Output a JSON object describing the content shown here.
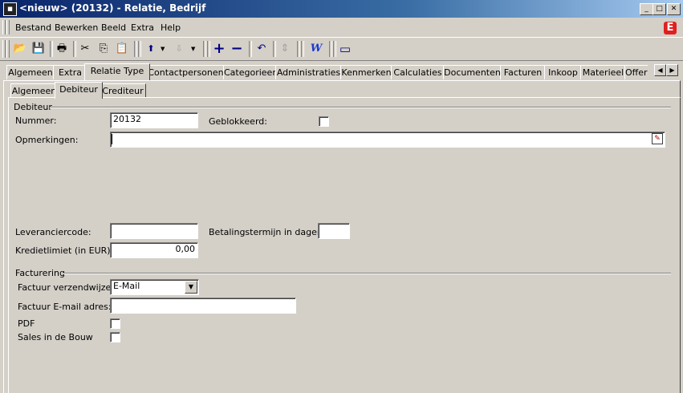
{
  "window": {
    "title": "<nieuw> (20132) - Relatie, Bedrijf",
    "minimize": "_",
    "maximize": "□",
    "close": "✕"
  },
  "menu": [
    "Bestand",
    "Bewerken",
    "Beeld",
    "Extra",
    "Help"
  ],
  "toolbar": {
    "icons": [
      "open-icon",
      "save-icon",
      "print-icon",
      "cut-icon",
      "copy-icon",
      "paste-icon",
      "arrow-up-icon",
      "arrow-down-icon",
      "add-icon",
      "remove-icon",
      "undo-icon",
      "refresh-icon",
      "word-icon",
      "window-icon"
    ],
    "glyphs": {
      "open": "📂",
      "save": "💾",
      "print": "🖶",
      "cut": "✂",
      "copy": "⎘",
      "paste": "📋",
      "up": "⬆",
      "down": "⇩",
      "add": "+",
      "remove": "−",
      "undo": "↶",
      "refresh": "⇕",
      "word": "W",
      "window": "▭"
    }
  },
  "main_tabs": [
    "Algemeen",
    "Extra",
    "Relatie Type",
    "Contactpersonen",
    "Categorieen",
    "Administraties",
    "Kenmerken",
    "Calculaties",
    "Documenten",
    "Facturen",
    "Inkoop",
    "Materieel",
    "Offer"
  ],
  "main_tab_active": "Relatie Type",
  "sub_tabs": [
    "Algemeen",
    "Debiteur",
    "Crediteur"
  ],
  "sub_tab_active": "Debiteur",
  "debiteur": {
    "group_label": "Debiteur",
    "nummer_label": "Nummer:",
    "nummer_value": "20132",
    "geblokkeerd_label": "Geblokkeerd:",
    "opmerkingen_label": "Opmerkingen:",
    "opmerkingen_value": "",
    "leverancierscode_label": "Leveranciercode:",
    "leverancierscode_value": "",
    "betalingstermijn_label": "Betalingstermijn in dagen:",
    "betalingstermijn_value": "",
    "kredietlimiet_label": "Kredietlimiet (in EUR):",
    "kredietlimiet_value": "0,00"
  },
  "facturering": {
    "group_label": "Facturering",
    "verzendwijze_label": "Factuur verzendwijze:",
    "verzendwijze_value": "E-Mail",
    "email_label": "Factuur E-mail adres:",
    "email_value": "",
    "pdf_label": "PDF",
    "sales_label": "Sales in de Bouw"
  },
  "brand_letter": "E"
}
